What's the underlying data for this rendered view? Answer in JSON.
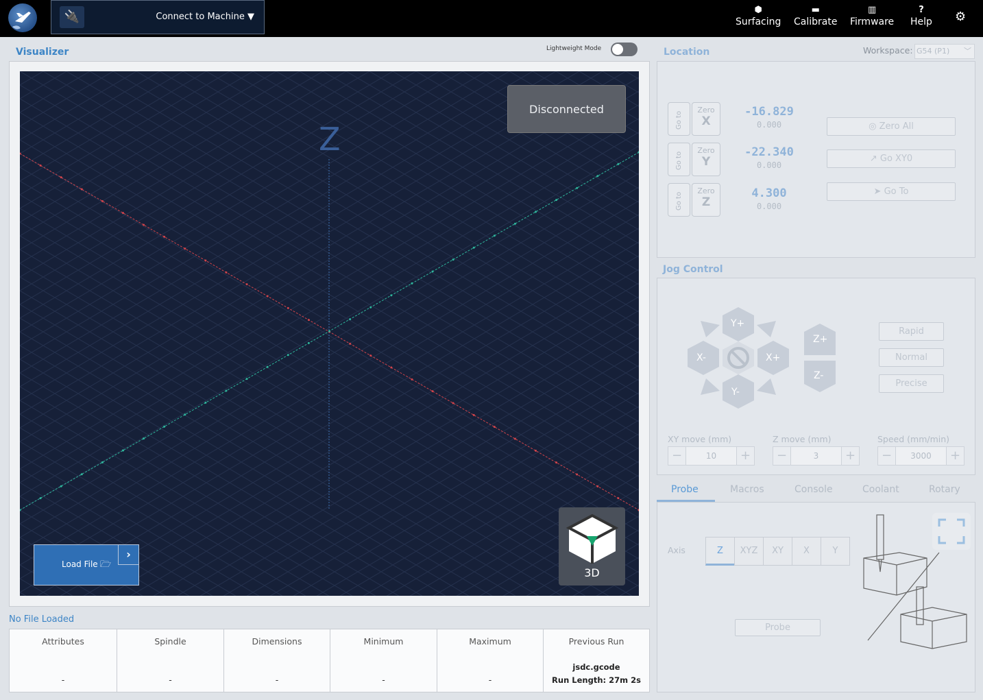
{
  "nav": {
    "connect_label": "Connect to Machine ▼",
    "items": [
      {
        "label": "Surfacing",
        "icon": "surfacing-icon",
        "glyph": "⬢"
      },
      {
        "label": "Calibrate",
        "icon": "calibrate-icon",
        "glyph": "▬"
      },
      {
        "label": "Firmware",
        "icon": "firmware-icon",
        "glyph": "▥"
      },
      {
        "label": "Help",
        "icon": "help-icon",
        "glyph": "?"
      }
    ],
    "settings_glyph": "⚙"
  },
  "visualizer": {
    "title": "Visualizer",
    "lightweight_label": "Lightweight Mode",
    "lightweight_on": false,
    "status": "Disconnected",
    "z_label": "Z",
    "load_file_label": "Load File",
    "load_file_arrow": "›",
    "view_label": "3D"
  },
  "file_info": {
    "status": "No File Loaded",
    "columns": [
      {
        "header": "Attributes",
        "value": "-"
      },
      {
        "header": "Spindle",
        "value": "-"
      },
      {
        "header": "Dimensions",
        "value": "-"
      },
      {
        "header": "Minimum",
        "value": "-"
      },
      {
        "header": "Maximum",
        "value": "-"
      }
    ],
    "previous_run": {
      "header": "Previous Run",
      "file": "jsdc.gcode",
      "run_length": "Run Length: 27m 2s"
    }
  },
  "location": {
    "title": "Location",
    "workspace_label": "Workspace:",
    "workspace_value": "G54 (P1)",
    "axes": [
      {
        "go": "Go to",
        "zero": "Zero",
        "axis": "X",
        "value": "-16.829",
        "machine": "0.000"
      },
      {
        "go": "Go to",
        "zero": "Zero",
        "axis": "Y",
        "value": "-22.340",
        "machine": "0.000"
      },
      {
        "go": "Go to",
        "zero": "Zero",
        "axis": "Z",
        "value": "4.300",
        "machine": "0.000"
      }
    ],
    "zero_all": "Zero All",
    "go_xy0": "Go XY0",
    "go_to": "Go  To"
  },
  "jog": {
    "title": "Jog Control",
    "yplus": "Y+",
    "yminus": "Y-",
    "xplus": "X+",
    "xminus": "X-",
    "zplus": "Z+",
    "zminus": "Z-",
    "speeds": [
      "Rapid",
      "Normal",
      "Precise"
    ],
    "xy_label": "XY move (mm)",
    "xy_value": "10",
    "z_label": "Z move (mm)",
    "z_value": "3",
    "speed_label": "Speed (mm/min)",
    "speed_value": "3000"
  },
  "tabs": [
    "Probe",
    "Macros",
    "Console",
    "Coolant",
    "Rotary"
  ],
  "probe": {
    "axis_label": "Axis",
    "axes": [
      "Z",
      "XYZ",
      "XY",
      "X",
      "Y"
    ],
    "selected": "Z",
    "probe_button": "Probe"
  },
  "colors": {
    "accent": "#3d85c6",
    "canvas": "#162038",
    "x_axis": "#d0444b",
    "y_axis": "#2fb59c"
  }
}
